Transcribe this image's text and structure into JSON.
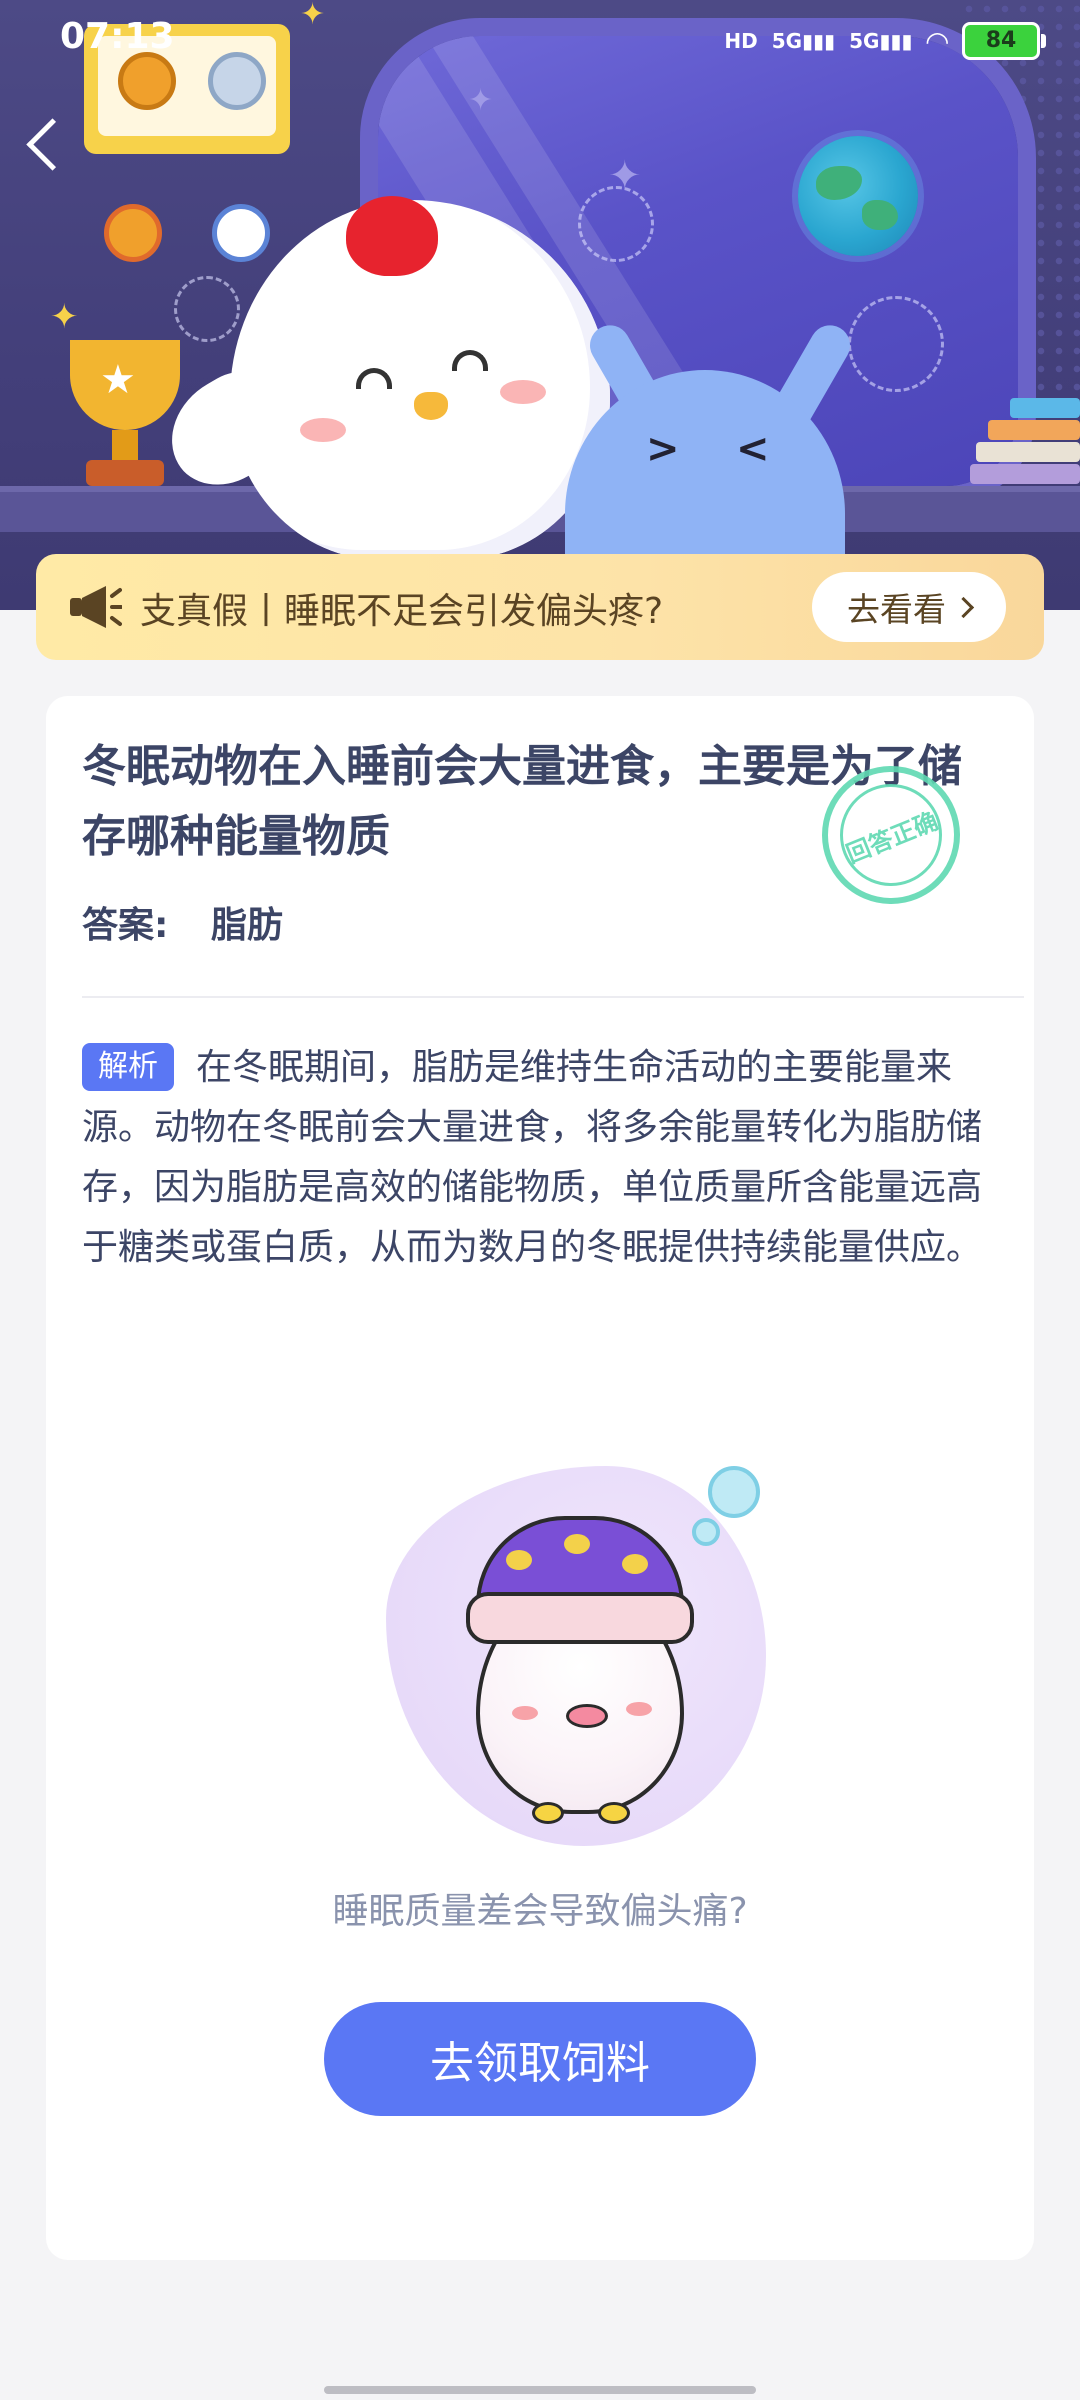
{
  "status_bar": {
    "time": "07:13",
    "network_labels": [
      "HD",
      "5G",
      "5G"
    ],
    "battery": "84"
  },
  "banner": {
    "text": "支真假丨睡眠不足会引发偏头疼?",
    "button_label": "去看看"
  },
  "question": {
    "title": "冬眠动物在入睡前会大量进食，主要是为了储存哪种能量物质",
    "answer_label": "答案:",
    "answer_value": "脂肪",
    "stamp_text": "回答正确"
  },
  "analysis": {
    "tag": "解析",
    "text": "在冬眠期间，脂肪是维持生命活动的主要能量来源。动物在冬眠前会大量进食，将多余能量转化为脂肪储存，因为脂肪是高效的储能物质，单位质量所含能量远高于糖类或蛋白质，从而为数月的冬眠提供持续能量供应。"
  },
  "footer": {
    "caption": "睡眠质量差会导致偏头痛?",
    "cta_label": "去领取饲料"
  },
  "colors": {
    "accent": "#5a77f4",
    "hero_bg": "#4d4a86",
    "banner_bg": "#fde3a8",
    "stamp": "#5fd9b2"
  },
  "icons": [
    "back-arrow-icon",
    "megaphone-icon",
    "chevron-right-icon",
    "wifi-icon",
    "signal-icon",
    "battery-icon"
  ]
}
